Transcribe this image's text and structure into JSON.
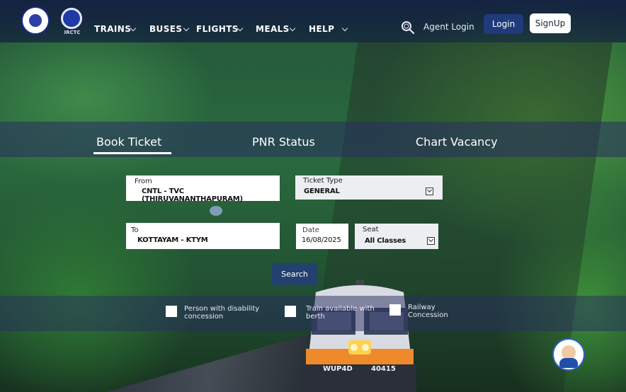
{
  "nav": {
    "trains": "TRAINS",
    "buses": "BUSES",
    "flights": "FLIGHTS",
    "meals": "MEALS",
    "help": "HELP",
    "agent_login": "Agent Login",
    "login": "Login",
    "signup": "SignUp"
  },
  "tabs": {
    "book": "Book Ticket",
    "pnr": "PNR Status",
    "chart": "Chart Vacancy"
  },
  "form": {
    "from_label": "From",
    "from_value": "CNTL - TVC (THIRUVANANTHAPURAM)",
    "to_label": "To",
    "to_value": "KOTTAYAM - KTYM",
    "ticket_type_label": "Ticket Type",
    "ticket_type_value": "GENERAL",
    "date_label": "Date",
    "date_value": "16/08/2025",
    "seat_label": "Seat",
    "seat_value": "All Classes",
    "search_label": "Search"
  },
  "options": {
    "disability_line1": "Person with  disability",
    "disability_line2": "concession",
    "berth_line1": "Train available with",
    "berth_line2": "berth",
    "railway_line1": "Railway",
    "railway_line2": "Concession"
  },
  "train": {
    "loco_code": "WUP4D",
    "loco_number": "40415"
  },
  "colors": {
    "header_bg": "#121e42",
    "login_bg": "#1f3b7a",
    "band_bg": "#282e60",
    "search_bg": "#24406e"
  }
}
